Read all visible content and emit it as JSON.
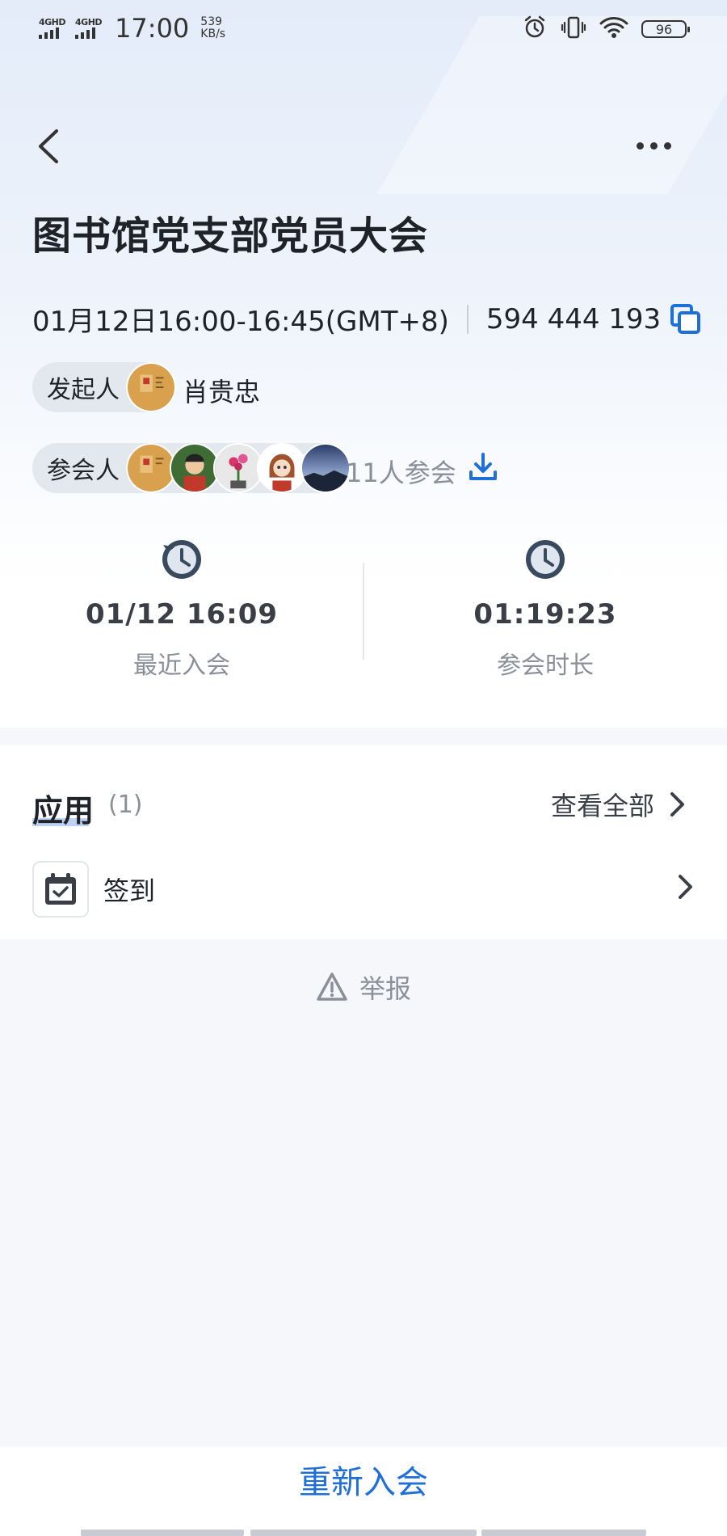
{
  "status_bar": {
    "network_1": "4GHD",
    "network_2": "4GHD",
    "time": "17:00",
    "speed_value": "539",
    "speed_unit": "KB/s",
    "battery": "96"
  },
  "meeting": {
    "title": "图书馆党支部党员大会",
    "time_range": "01月12日16:00-16:45(GMT+8)",
    "meeting_id": "594 444 193"
  },
  "host": {
    "label": "发起人",
    "name": "肖贵忠"
  },
  "participants": {
    "label": "参会人",
    "count_text": "11人参会"
  },
  "stats": {
    "last_join_value": "01/12 16:09",
    "last_join_label": "最近入会",
    "duration_value": "01:19:23",
    "duration_label": "参会时长"
  },
  "apps": {
    "title": "应用",
    "count": "(1)",
    "view_all": "查看全部",
    "items": [
      {
        "label": "签到",
        "icon": "calendar-check-icon"
      }
    ]
  },
  "report": {
    "label": "举报"
  },
  "bottom": {
    "rejoin_label": "重新入会"
  },
  "colors": {
    "accent": "#1e6fd9",
    "text_primary": "#1f2329",
    "text_secondary": "#8a8f99"
  }
}
